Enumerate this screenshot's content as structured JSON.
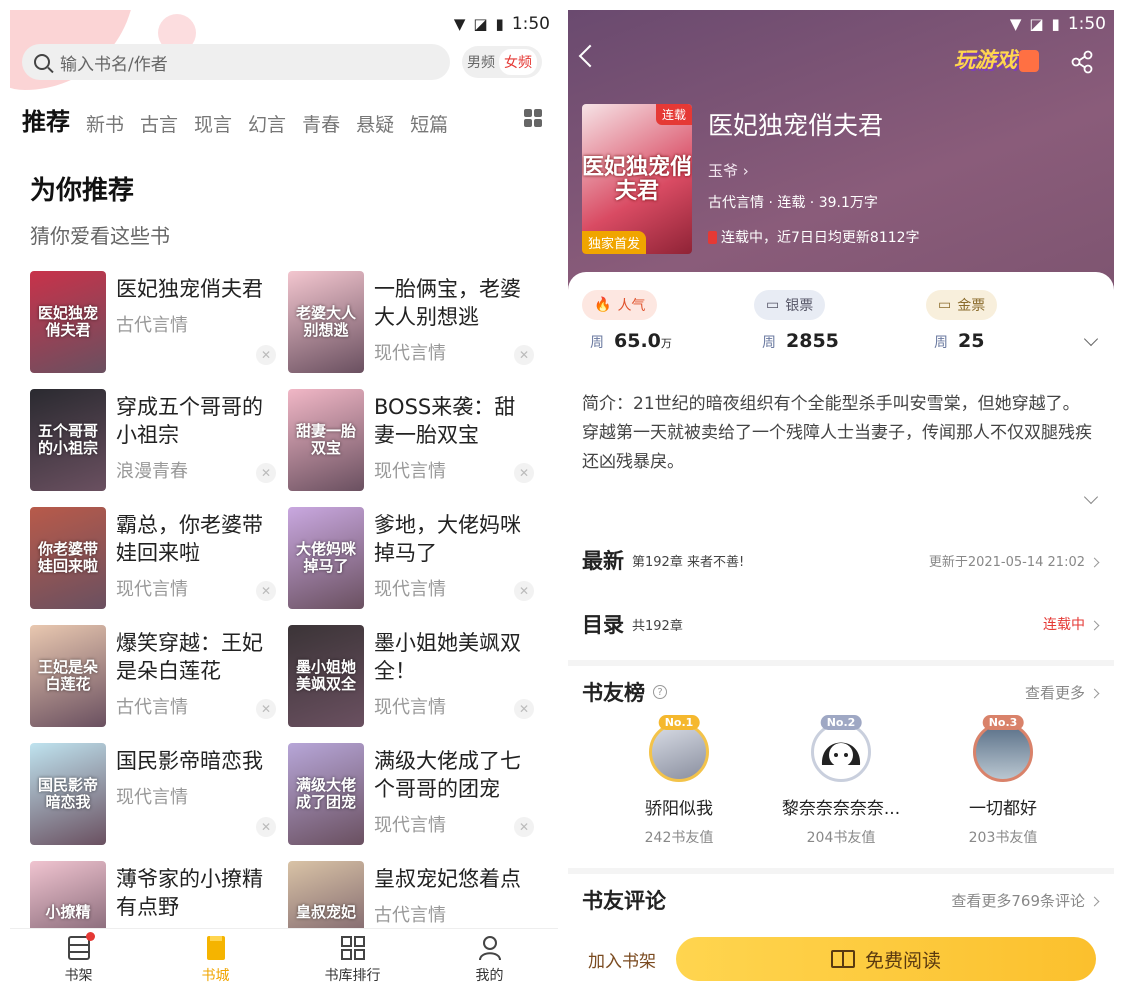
{
  "left": {
    "status": {
      "time": "1:50"
    },
    "search": {
      "placeholder": "输入书名/作者"
    },
    "gender": {
      "male": "男频",
      "female": "女频"
    },
    "tabs": [
      "推荐",
      "新书",
      "古言",
      "现言",
      "幻言",
      "青春",
      "悬疑",
      "短篇"
    ],
    "section": {
      "title": "为你推荐",
      "subtitle": "猜你爱看这些书"
    },
    "books": [
      {
        "title": "医妃独宠俏夫君",
        "genre": "古代言情",
        "cover_text": "医妃独宠俏夫君",
        "color": "#c8324a"
      },
      {
        "title": "一胎俩宝，老婆大人别想逃",
        "genre": "现代言情",
        "cover_text": "老婆大人别想逃",
        "color": "#f3c6cf"
      },
      {
        "title": "穿成五个哥哥的小祖宗",
        "genre": "浪漫青春",
        "cover_text": "五个哥哥的小祖宗",
        "color": "#2a2a30"
      },
      {
        "title": "BOSS来袭：甜妻一胎双宝",
        "genre": "现代言情",
        "cover_text": "甜妻一胎双宝",
        "color": "#f1b7c6"
      },
      {
        "title": "霸总，你老婆带娃回来啦",
        "genre": "现代言情",
        "cover_text": "你老婆带娃回来啦",
        "color": "#b85a4a"
      },
      {
        "title": "爹地，大佬妈咪掉马了",
        "genre": "现代言情",
        "cover_text": "大佬妈咪掉马了",
        "color": "#c9a8e0"
      },
      {
        "title": "爆笑穿越：王妃是朵白莲花",
        "genre": "古代言情",
        "cover_text": "王妃是朵白莲花",
        "color": "#e9c8b0"
      },
      {
        "title": "墨小姐她美飒双全！",
        "genre": "现代言情",
        "cover_text": "墨小姐她美飒双全",
        "color": "#3b3437"
      },
      {
        "title": "国民影帝暗恋我",
        "genre": "现代言情",
        "cover_text": "国民影帝暗恋我",
        "color": "#bfe3ef"
      },
      {
        "title": "满级大佬成了七个哥哥的团宠",
        "genre": "现代言情",
        "cover_text": "满级大佬成了团宠",
        "color": "#b7a6d8"
      },
      {
        "title": "薄爷家的小撩精有点野",
        "genre": "",
        "cover_text": "小撩精",
        "color": "#f0c4d0"
      },
      {
        "title": "皇叔宠妃悠着点",
        "genre": "古代言情",
        "cover_text": "皇叔宠妃",
        "color": "#d9c3a6"
      }
    ],
    "nav": [
      {
        "label": "书架"
      },
      {
        "label": "书城"
      },
      {
        "label": "书库排行"
      },
      {
        "label": "我的"
      }
    ]
  },
  "right": {
    "status": {
      "time": "1:50"
    },
    "play_label": "玩游戏",
    "book": {
      "title": "医妃独宠俏夫君",
      "author": "玉爷",
      "meta": "古代言情 · 连载 · 39.1万字",
      "update": "连载中，近7日日均更新8112字",
      "cover_text": "医妃独宠俏夫君",
      "badge_serial": "连载",
      "badge_exclusive": "独家首发"
    },
    "stats": [
      {
        "label": "人气",
        "period": "周",
        "value": "65.0",
        "unit": "万"
      },
      {
        "label": "银票",
        "period": "周",
        "value": "2855",
        "unit": ""
      },
      {
        "label": "金票",
        "period": "周",
        "value": "25",
        "unit": ""
      }
    ],
    "intro": {
      "line1": "简介：21世纪的暗夜组织有个全能型杀手叫安雪棠，但她穿越了。",
      "line2": "穿越第一天就被卖给了一个残障人士当妻子，传闻那人不仅双腿残疾还凶残暴戾。"
    },
    "latest": {
      "label": "最新",
      "chapter": "第192章 来者不善!",
      "time": "更新于2021-05-14 21:02"
    },
    "toc": {
      "label": "目录",
      "count": "共192章",
      "status": "连载中"
    },
    "rank": {
      "title": "书友榜",
      "more": "查看更多",
      "items": [
        {
          "tag": "No.1",
          "name": "骄阳似我",
          "value": "242书友值",
          "tag_color": "#f5b82e"
        },
        {
          "tag": "No.2",
          "name": "黎奈奈奈奈奈...",
          "value": "204书友值",
          "tag_color": "#9fa8c4"
        },
        {
          "tag": "No.3",
          "name": "一切都好",
          "value": "203书友值",
          "tag_color": "#d9826a"
        }
      ]
    },
    "comments": {
      "title": "书友评论",
      "more": "查看更多769条评论"
    },
    "footer": {
      "add": "加入书架",
      "read": "免费阅读"
    }
  }
}
